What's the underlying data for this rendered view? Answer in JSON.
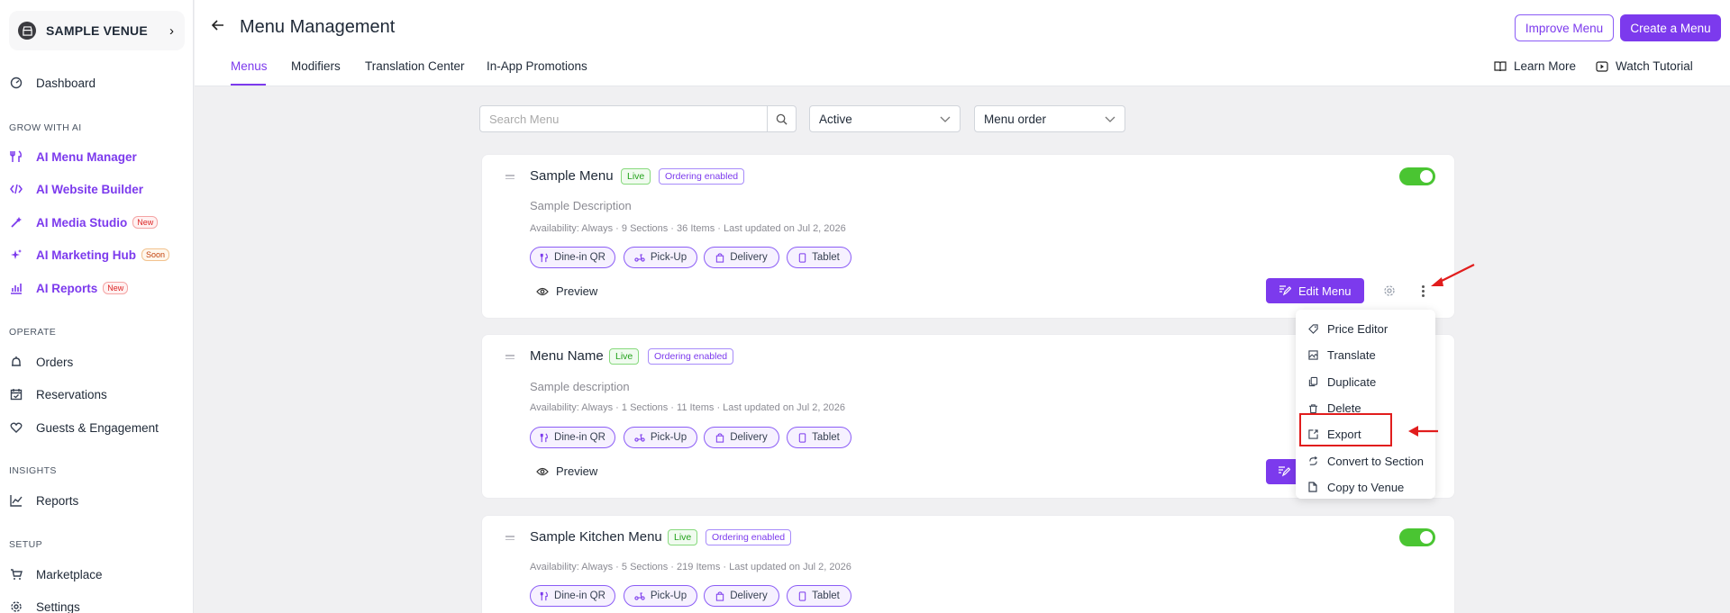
{
  "sidebar": {
    "venue_name": "SAMPLE VENUE",
    "dashboard": "Dashboard",
    "grow_label": "GROW WITH AI",
    "ai_items": [
      {
        "label": "AI Menu Manager",
        "icon": "utensils-icon"
      },
      {
        "label": "AI Website Builder",
        "icon": "code-icon"
      },
      {
        "label": "AI Media Studio",
        "icon": "magic-wand-icon",
        "tag": "New"
      },
      {
        "label": "AI Marketing Hub",
        "icon": "sparkles-icon",
        "tag": "Soon"
      },
      {
        "label": "AI Reports",
        "icon": "bar-chart-icon",
        "tag": "New"
      }
    ],
    "operate_label": "OPERATE",
    "operate_items": [
      "Orders",
      "Reservations",
      "Guests & Engagement"
    ],
    "insights_label": "INSIGHTS",
    "insights_items": [
      "Reports"
    ],
    "setup_label": "SETUP",
    "setup_items": [
      "Marketplace",
      "Settings"
    ]
  },
  "header": {
    "title": "Menu Management",
    "improve_label": "Improve Menu",
    "create_label": "Create a Menu",
    "tabs": [
      "Menus",
      "Modifiers",
      "Translation Center",
      "In-App Promotions"
    ],
    "learn_more": "Learn More",
    "watch_tutorial": "Watch Tutorial"
  },
  "filters": {
    "search_placeholder": "Search Menu",
    "status": "Active",
    "sort": "Menu order"
  },
  "cards": [
    {
      "name": "Sample Menu",
      "live": "Live",
      "ordering": "Ordering enabled",
      "description": "Sample Description",
      "meta": "Availability: Always · 9 Sections · 36 Items · Last updated on Jul 2, 2026",
      "chips": [
        "Dine-in QR",
        "Pick-Up",
        "Delivery",
        "Tablet"
      ],
      "preview": "Preview",
      "edit": "Edit Menu",
      "enabled": true
    },
    {
      "name": "Menu Name",
      "live": "Live",
      "ordering": "Ordering enabled",
      "description": "Sample description",
      "meta": "Availability: Always · 1 Sections · 11 Items · Last updated on Jul 2, 2026",
      "chips": [
        "Dine-in QR",
        "Pick-Up",
        "Delivery",
        "Tablet"
      ],
      "preview": "Preview"
    },
    {
      "name": "Sample Kitchen Menu",
      "live": "Live",
      "ordering": "Ordering enabled",
      "meta": "Availability: Always · 5 Sections · 219 Items · Last updated on Jul 2, 2026",
      "chips": [
        "Dine-in QR",
        "Pick-Up",
        "Delivery",
        "Tablet"
      ],
      "enabled": true
    }
  ],
  "context_menu": {
    "items": [
      "Price Editor",
      "Translate",
      "Duplicate",
      "Delete",
      "Export",
      "Convert to Section",
      "Copy to Venue"
    ],
    "highlighted": "Export"
  },
  "colors": {
    "accent": "#7c3aed",
    "toggle_on": "#4ac532",
    "annotation": "#e11d1d"
  }
}
